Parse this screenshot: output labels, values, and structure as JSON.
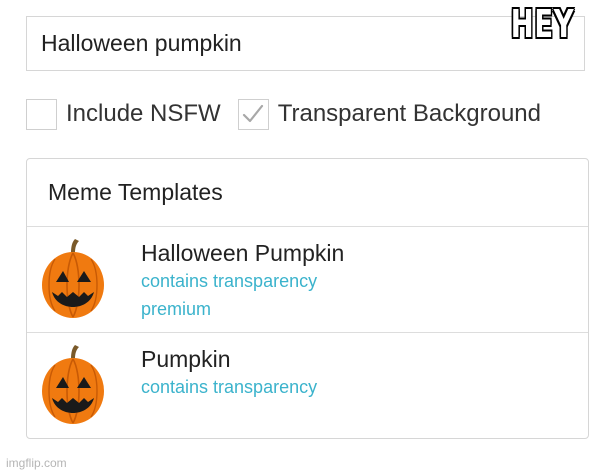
{
  "search": {
    "value": "Halloween pumpkin"
  },
  "overlay_text": "HEY",
  "options": [
    {
      "label": "Include NSFW",
      "checked": false
    },
    {
      "label": "Transparent Background",
      "checked": true
    }
  ],
  "panel": {
    "title": "Meme Templates",
    "items": [
      {
        "title": "Halloween Pumpkin",
        "tags": [
          "contains transparency",
          "premium"
        ],
        "icon": "jack-o-lantern"
      },
      {
        "title": "Pumpkin",
        "tags": [
          "contains transparency"
        ],
        "icon": "jack-o-lantern"
      }
    ]
  },
  "watermark": "imgflip.com",
  "colors": {
    "meta_text": "#3bb3cc",
    "pumpkin_orange": "#f07a10",
    "stem": "#7a5a2a"
  }
}
